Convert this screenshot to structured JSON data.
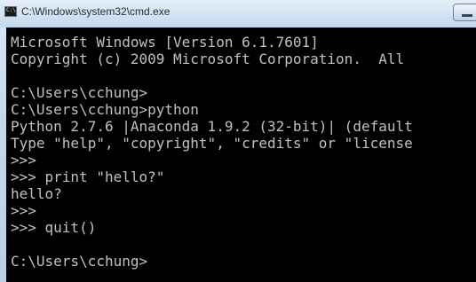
{
  "window": {
    "title": "C:\\Windows\\system32\\cmd.exe",
    "icon_glyph": "C:\\"
  },
  "console": {
    "lines": [
      "Microsoft Windows [Version 6.1.7601]",
      "Copyright (c) 2009 Microsoft Corporation.  All",
      "",
      "C:\\Users\\cchung>",
      "C:\\Users\\cchung>python",
      "Python 2.7.6 |Anaconda 1.9.2 (32-bit)| (default",
      "Type \"help\", \"copyright\", \"credits\" or \"license",
      ">>>",
      ">>> print \"hello?\"",
      "hello?",
      ">>>",
      ">>> quit()",
      "",
      "C:\\Users\\cchung>"
    ]
  },
  "colors": {
    "console_background": "#000000",
    "console_text": "#c0c0c0",
    "titlebar": "#d2e2f2"
  },
  "icons": {
    "window_icon": "cmd-icon",
    "minimize_button": "minimize-icon"
  }
}
